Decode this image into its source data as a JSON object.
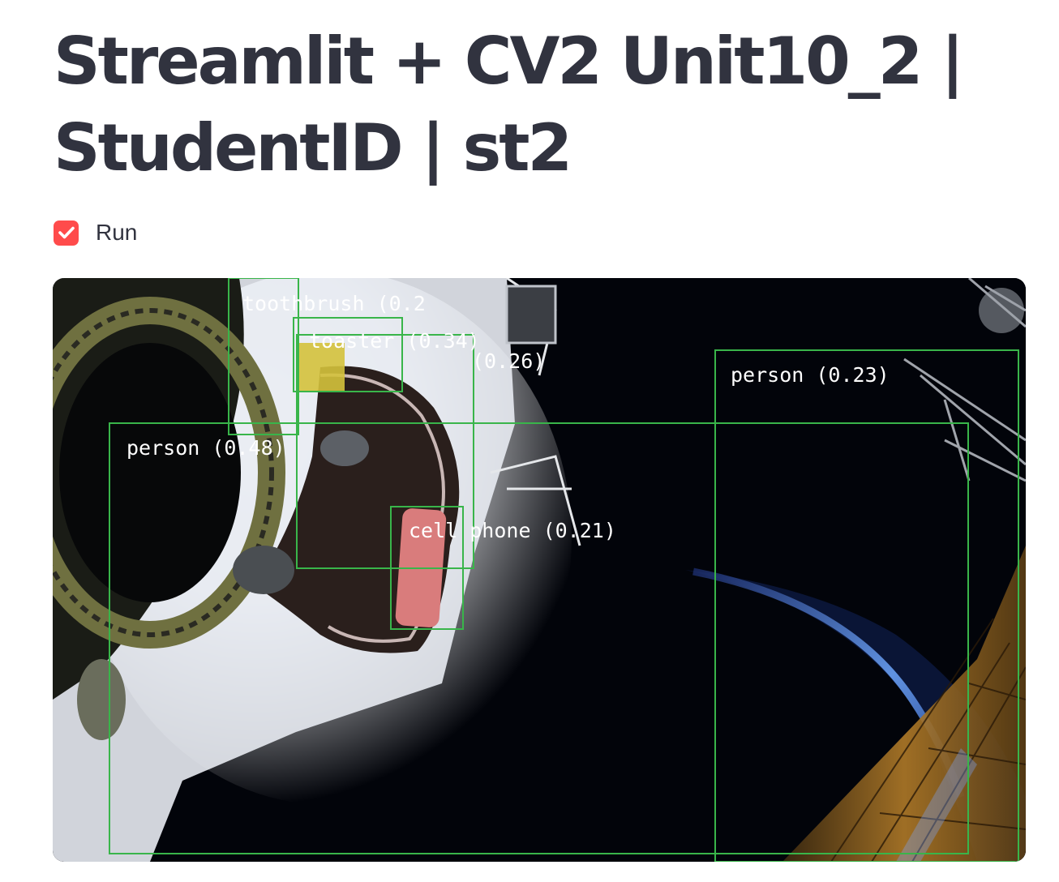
{
  "page": {
    "title": "Streamlit + CV2 Unit10_2 | StudentID | st2"
  },
  "controls": {
    "run": {
      "label": "Run",
      "checked": true,
      "accent_color": "#ff4b4b"
    }
  },
  "video_frame": {
    "box_color": "#39b54a",
    "detections": [
      {
        "label": "toothbrush (0.2"
      },
      {
        "label": "toaster (0.34)"
      },
      {
        "label": "(0.26)"
      },
      {
        "label": "person (0.48)"
      },
      {
        "label": "cell phone (0.21)"
      },
      {
        "label": "person (0.23)"
      }
    ]
  }
}
